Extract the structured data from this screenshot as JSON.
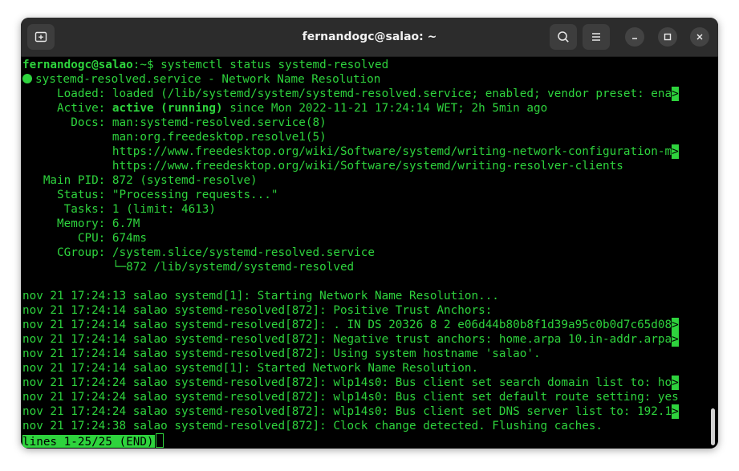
{
  "window": {
    "title": "fernandogc@salao: ~"
  },
  "icons": {
    "new_tab": "new-tab-icon",
    "search": "search-icon",
    "menu": "hamburger-menu-icon",
    "minimize": "minimize-icon",
    "maximize": "maximize-icon",
    "close": "close-icon"
  },
  "colors": {
    "terminal_fg": "#2ed33d",
    "terminal_bg": "#000000",
    "titlebar_bg": "#2c2c2c"
  },
  "terminal": {
    "prompt_user": "fernandogc@salao",
    "prompt_rest": ":~$ systemctl status systemd-resolved",
    "service_line": "systemd-resolved.service - Network Name Resolution",
    "loaded": "     Loaded: loaded (/lib/systemd/system/systemd-resolved.service; enabled; vendor preset: ena",
    "active_prefix": "     Active: ",
    "active_state": "active (running)",
    "active_rest": " since Mon 2022-11-21 17:24:14 WET; 2h 5min ago",
    "docs1": "       Docs: man:systemd-resolved.service(8)",
    "docs2": "             man:org.freedesktop.resolve1(5)",
    "docs3": "             https://www.freedesktop.org/wiki/Software/systemd/writing-network-configuration-m",
    "docs4": "             https://www.freedesktop.org/wiki/Software/systemd/writing-resolver-clients",
    "main_pid": "   Main PID: 872 (systemd-resolve)",
    "status": "     Status: \"Processing requests...\"",
    "tasks": "      Tasks: 1 (limit: 4613)",
    "memory": "     Memory: 6.7M",
    "cpu": "        CPU: 674ms",
    "cgroup": "     CGroup: /system.slice/systemd-resolved.service",
    "cgroup_proc": "             └─872 /lib/systemd/systemd-resolved",
    "truncation_marker": ">",
    "log": [
      "nov 21 17:24:13 salao systemd[1]: Starting Network Name Resolution...",
      "nov 21 17:24:14 salao systemd-resolved[872]: Positive Trust Anchors:",
      "nov 21 17:24:14 salao systemd-resolved[872]: . IN DS 20326 8 2 e06d44b80b8f1d39a95c0b0d7c65d08",
      "nov 21 17:24:14 salao systemd-resolved[872]: Negative trust anchors: home.arpa 10.in-addr.arpa",
      "nov 21 17:24:14 salao systemd-resolved[872]: Using system hostname 'salao'.",
      "nov 21 17:24:14 salao systemd[1]: Started Network Name Resolution.",
      "nov 21 17:24:24 salao systemd-resolved[872]: wlp14s0: Bus client set search domain list to: ho",
      "nov 21 17:24:24 salao systemd-resolved[872]: wlp14s0: Bus client set default route setting: yes",
      "nov 21 17:24:24 salao systemd-resolved[872]: wlp14s0: Bus client set DNS server list to: 192.1",
      "nov 21 17:24:38 salao systemd-resolved[872]: Clock change detected. Flushing caches."
    ],
    "pager_status": "lines 1-25/25 (END)"
  }
}
